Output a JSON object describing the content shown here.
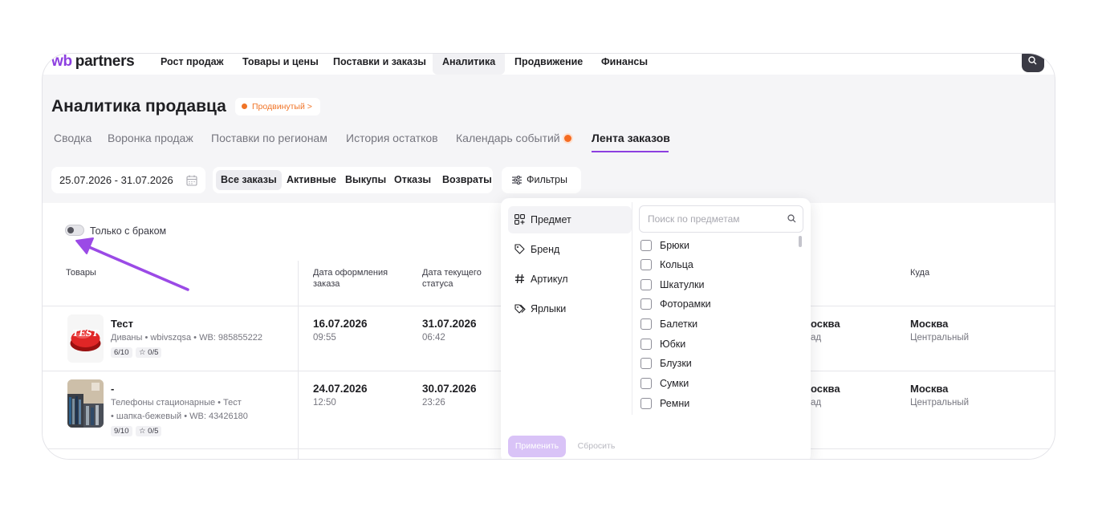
{
  "logo": {
    "brand": "wb",
    "name": "partners"
  },
  "nav": {
    "items": [
      "Рост продаж",
      "Товары и цены",
      "Поставки и заказы",
      "Аналитика",
      "Продвижение",
      "Финансы"
    ],
    "active": "Аналитика"
  },
  "page": {
    "title": "Аналитика продавца",
    "badge": "Продвинутый",
    "badge_chevron": ">"
  },
  "tabs": [
    "Сводка",
    "Воронка продаж",
    "Поставки по регионам",
    "История остатков",
    "Календарь событий",
    "Лента заказов"
  ],
  "tabs_active": "Лента заказов",
  "date_range": "25.07.2026 - 31.07.2026",
  "segments": [
    "Все заказы",
    "Активные",
    "Выкупы",
    "Отказы",
    "Возвраты"
  ],
  "segments_active": "Все заказы",
  "filters_label": "Фильтры",
  "toggle_label": "Только с браком",
  "table": {
    "headers": {
      "products": "Товары",
      "order_date": "Дата оформления заказа",
      "status_date": "Дата текущего статуса",
      "destination": "Куда"
    },
    "rows": [
      {
        "title": "Тест",
        "subtitle": "Диваны • wbivszqsa • WB: 985855222",
        "rating": "6/10",
        "stars": "☆ 0/5",
        "thumb_text": "TEST",
        "order_date": "16.07.2026",
        "order_time": "09:55",
        "status_date": "31.07.2026",
        "status_time": "06:42",
        "from_city": "осква",
        "from_sub": "ад",
        "to_city": "Москва",
        "to_sub": "Центральный"
      },
      {
        "title": "-",
        "subtitle_1": "Телефоны стационарные • Тест",
        "subtitle_2": "• шапка-бежевый • WB: 43426180",
        "rating": "9/10",
        "stars": "☆ 0/5",
        "order_date": "24.07.2026",
        "order_time": "12:50",
        "status_date": "30.07.2026",
        "status_time": "23:26",
        "from_city": "осква",
        "from_sub": "ад",
        "to_city": "Москва",
        "to_sub": "Центральный"
      }
    ]
  },
  "filter_panel": {
    "categories": [
      "Предмет",
      "Бренд",
      "Артикул",
      "Ярлыки"
    ],
    "active_category": "Предмет",
    "search_placeholder": "Поиск по предметам",
    "options": [
      "Брюки",
      "Кольца",
      "Шкатулки",
      "Фоторамки",
      "Балетки",
      "Юбки",
      "Блузки",
      "Сумки",
      "Ремни"
    ],
    "apply": "Применить",
    "reset": "Сбросить"
  },
  "colors": {
    "accent": "#8d3fe0",
    "badge_orange": "#f07427",
    "apply_disabled": "#d9c3f7",
    "annotation_arrow": "#9b4ae6"
  },
  "icons": {
    "search": "search-icon",
    "calendar": "calendar-icon",
    "filters": "sliders-icon",
    "subject": "grid-icon",
    "brand": "tag-icon",
    "article": "hash-icon",
    "labels": "labels-icon"
  }
}
